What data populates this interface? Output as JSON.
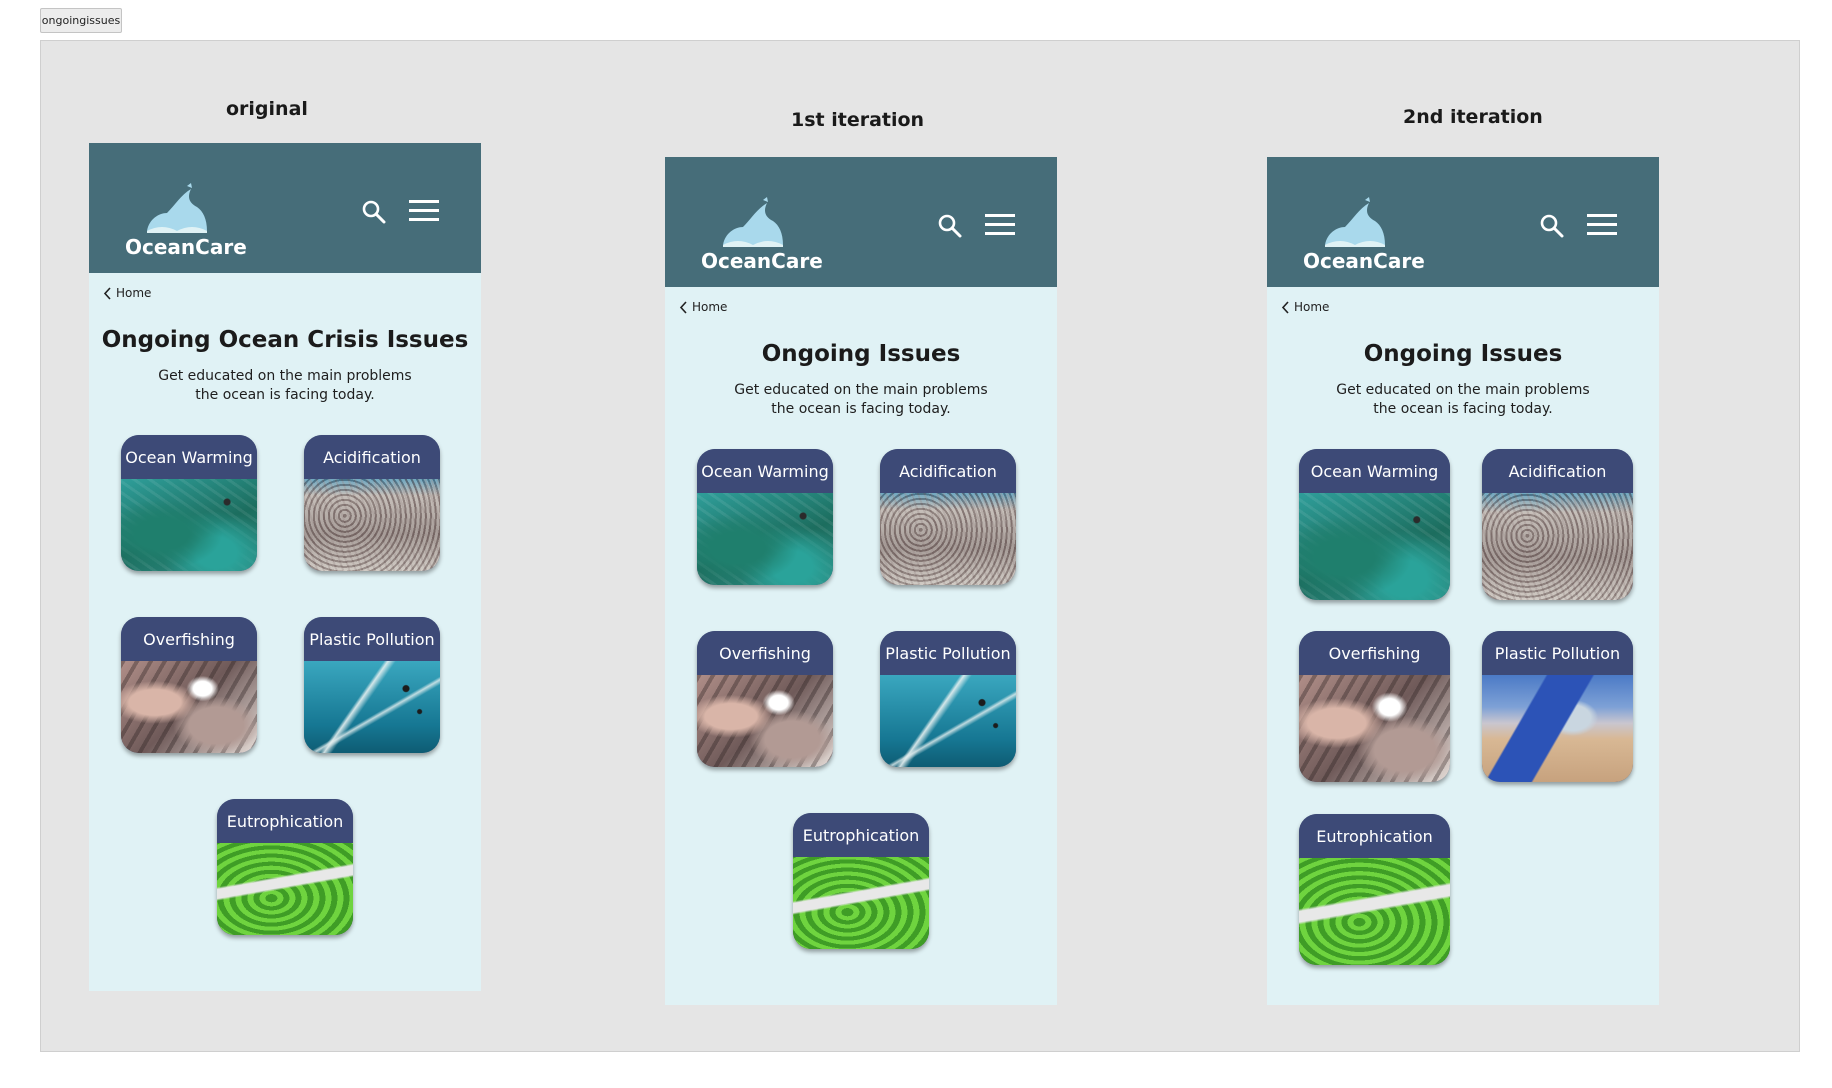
{
  "frame": {
    "name": "ongoingissues"
  },
  "columns": [
    {
      "heading": "original",
      "brand": "OceanCare",
      "back_label": "Home",
      "title": "Ongoing Ocean Crisis Issues",
      "subtitle_line1": "Get educated on the main problems",
      "subtitle_line2": "the ocean is facing today.",
      "cards": [
        "Ocean Warming",
        "Acidification",
        "Overfishing",
        "Plastic Pollution",
        "Eutrophication"
      ]
    },
    {
      "heading": "1st iteration",
      "brand": "OceanCare",
      "back_label": "Home",
      "title": "Ongoing Issues",
      "subtitle_line1": "Get educated on the main problems",
      "subtitle_line2": "the ocean is facing today.",
      "cards": [
        "Ocean Warming",
        "Acidification",
        "Overfishing",
        "Plastic Pollution",
        "Eutrophication"
      ]
    },
    {
      "heading": "2nd iteration",
      "brand": "OceanCare",
      "back_label": "Home",
      "title": "Ongoing Issues",
      "subtitle_line1": "Get educated on the main problems",
      "subtitle_line2": "the ocean is facing today.",
      "cards": [
        "Ocean Warming",
        "Acidification",
        "Overfishing",
        "Plastic Pollution",
        "Eutrophication"
      ]
    }
  ],
  "icons": {
    "logo": "wave-logo-icon",
    "search": "search-icon",
    "menu": "hamburger-menu-icon",
    "back": "chevron-left-icon"
  },
  "colors": {
    "header": "#466d79",
    "page": "#e0f2f5",
    "card_label": "#3d4a77",
    "logo_wave": "#a9d9ec",
    "canvas": "#e5e5e5"
  }
}
